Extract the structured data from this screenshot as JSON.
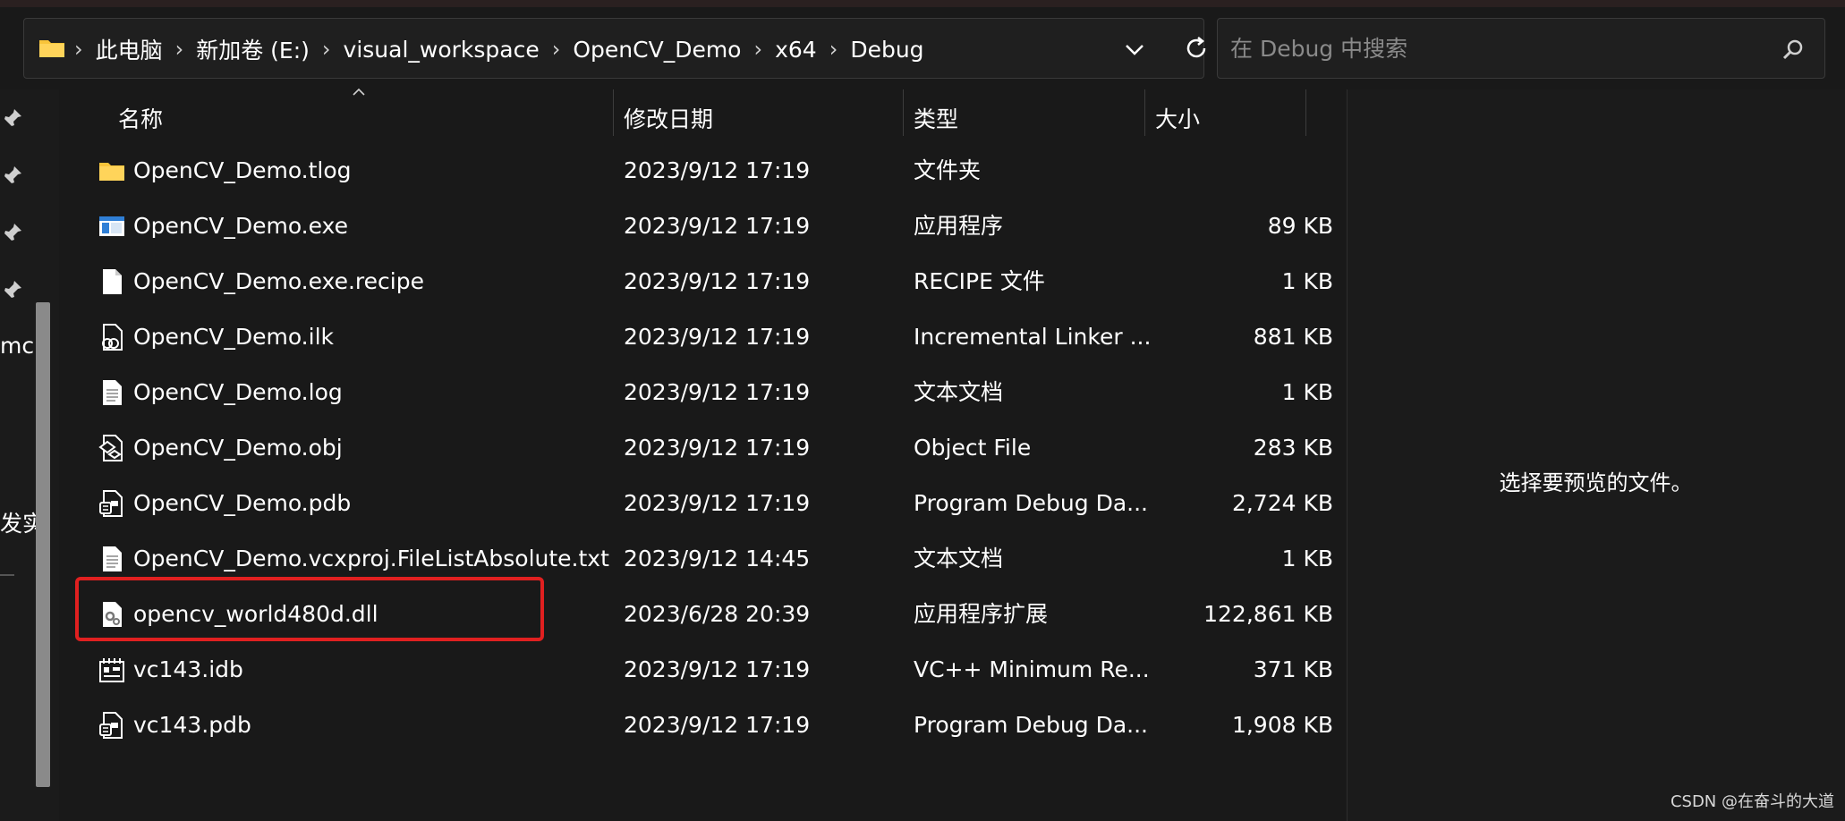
{
  "address": {
    "breadcrumbs": [
      "此电脑",
      "新加卷 (E:)",
      "visual_workspace",
      "OpenCV_Demo",
      "x64",
      "Debug"
    ]
  },
  "search": {
    "placeholder": "在 Debug 中搜索"
  },
  "left_nav": {
    "fragment_1": "mc",
    "fragment_2": "发实"
  },
  "columns": {
    "name": "名称",
    "date": "修改日期",
    "type": "类型",
    "size": "大小"
  },
  "files": [
    {
      "icon": "folder-icon",
      "name": "OpenCV_Demo.tlog",
      "date": "2023/9/12 17:19",
      "type": "文件夹",
      "size": ""
    },
    {
      "icon": "exe-icon",
      "name": "OpenCV_Demo.exe",
      "date": "2023/9/12 17:19",
      "type": "应用程序",
      "size": "89 KB"
    },
    {
      "icon": "file-icon",
      "name": "OpenCV_Demo.exe.recipe",
      "date": "2023/9/12 17:19",
      "type": "RECIPE 文件",
      "size": "1 KB"
    },
    {
      "icon": "ilk-icon",
      "name": "OpenCV_Demo.ilk",
      "date": "2023/9/12 17:19",
      "type": "Incremental Linker ...",
      "size": "881 KB"
    },
    {
      "icon": "text-file-icon",
      "name": "OpenCV_Demo.log",
      "date": "2023/9/12 17:19",
      "type": "文本文档",
      "size": "1 KB"
    },
    {
      "icon": "obj-icon",
      "name": "OpenCV_Demo.obj",
      "date": "2023/9/12 17:19",
      "type": "Object File",
      "size": "283 KB"
    },
    {
      "icon": "pdb-icon",
      "name": "OpenCV_Demo.pdb",
      "date": "2023/9/12 17:19",
      "type": "Program Debug Da...",
      "size": "2,724 KB"
    },
    {
      "icon": "text-file-icon",
      "name": "OpenCV_Demo.vcxproj.FileListAbsolute.txt",
      "date": "2023/9/12 14:45",
      "type": "文本文档",
      "size": "1 KB"
    },
    {
      "icon": "dll-icon",
      "name": "opencv_world480d.dll",
      "date": "2023/6/28 20:39",
      "type": "应用程序扩展",
      "size": "122,861 KB"
    },
    {
      "icon": "idb-icon",
      "name": "vc143.idb",
      "date": "2023/9/12 17:19",
      "type": "VC++ Minimum Re...",
      "size": "371 KB"
    },
    {
      "icon": "pdb-icon",
      "name": "vc143.pdb",
      "date": "2023/9/12 17:19",
      "type": "Program Debug Da...",
      "size": "1,908 KB"
    }
  ],
  "highlighted_file": "opencv_world480d.dll",
  "preview": {
    "message": "选择要预览的文件。"
  },
  "watermark": "CSDN @在奋斗的大道",
  "colors": {
    "background": "#191919",
    "highlight_box": "#e02020",
    "folder": "#f8c43a"
  }
}
